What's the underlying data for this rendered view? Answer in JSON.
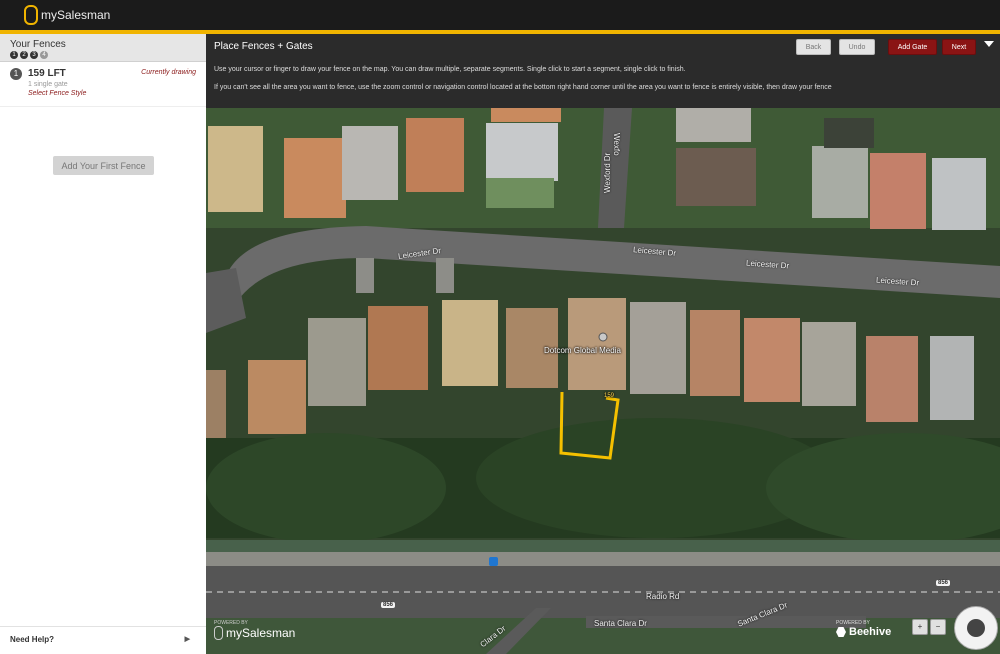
{
  "app": {
    "name": "mySalesman"
  },
  "sidebar": {
    "title": "Your Fences",
    "steps": [
      "1",
      "2",
      "3",
      "4"
    ],
    "fence": {
      "number": "1",
      "length": "159 LFT",
      "gates": "1 single gate",
      "style_link": "Select Fence Style",
      "status": "Currently drawing"
    },
    "add_button": "Add Your First Fence",
    "help": "Need Help?"
  },
  "panel": {
    "title": "Place Fences + Gates",
    "instruction1": "Use your cursor or finger to draw your fence on the map. You can draw multiple, separate segments. Single click to start a segment, single click to finish.",
    "instruction2": "If you can't see all the area you want to fence, use the zoom control or navigation control located at the bottom right hand corner until the area you want to fence is entirely visible, then draw your fence",
    "buttons": {
      "back": "Back",
      "undo": "Undo",
      "add_gate": "Add Gate",
      "next": "Next"
    }
  },
  "map": {
    "roads": {
      "leicester1": "Leicester Dr",
      "leicester2": "Leicester Dr",
      "leicester3": "Leicester Dr",
      "leicester4": "Leicester Dr",
      "wexford1": "Wexford Dr",
      "wexford2": "Wexfo",
      "radio": "Radio Rd",
      "santa1": "Santa Clara Dr",
      "santa2": "Santa Clara Dr",
      "clara": "Clara Dr"
    },
    "marker": "Dotcom Global Media",
    "fence_label": "159",
    "shield1": "856",
    "shield2": "856",
    "powered_left": {
      "small": "POWERED BY",
      "brand": "mySalesman"
    },
    "powered_right": {
      "small": "POWERED BY",
      "brand": "Beehive"
    },
    "zoom_in": "+",
    "zoom_out": "−"
  }
}
